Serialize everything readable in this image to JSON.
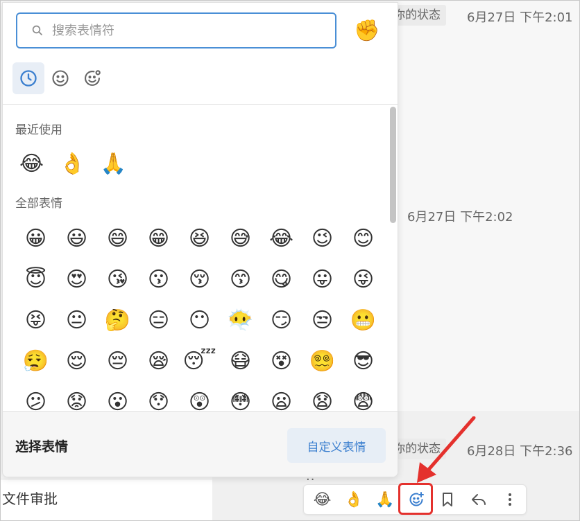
{
  "chat": {
    "status_label": "你的状态",
    "time_1": "6月27日 下午2:01",
    "time_2": "6月27日 下午2:02",
    "status_label_2": "你的状态",
    "time_3": "6月28日 下午2:36",
    "msg_fragment": "..",
    "sidebar_item": "文件审批"
  },
  "picker": {
    "search_placeholder": "搜索表情符",
    "skin_tone_emoji": "✊",
    "tabs": [
      {
        "name": "recent",
        "icon": "clock-icon",
        "active": true
      },
      {
        "name": "smileys",
        "icon": "smiley-icon",
        "active": false
      },
      {
        "name": "custom",
        "icon": "smiley-gear-icon",
        "active": false
      }
    ],
    "recent_title": "最近使用",
    "recent": [
      "😂",
      "👌",
      "🙏"
    ],
    "all_title": "全部表情",
    "all_rows": [
      [
        "😀",
        "😃",
        "😄",
        "😁",
        "😆",
        "😅",
        "😂",
        "😉",
        "😊"
      ],
      [
        "😇",
        "😍",
        "😘",
        "😗",
        "😚",
        "😙",
        "😋",
        "😛",
        "😜"
      ],
      [
        "😝",
        "😐",
        "🤔",
        "😑",
        "😶",
        "😶‍🌫️",
        "😏",
        "😒",
        "😬"
      ],
      [
        "😮‍💨",
        "😌",
        "😔",
        "😪",
        "😴",
        "😷",
        "😵",
        "😵‍💫",
        "😎"
      ],
      [
        "😕",
        "😟",
        "😮",
        "😯",
        "😲",
        "😳",
        "😦",
        "😧",
        "😨"
      ]
    ],
    "footer_title": "选择表情",
    "custom_button": "自定义表情"
  },
  "toolbar": {
    "quick_reactions": [
      "😂",
      "👌",
      "🙏"
    ],
    "add_reaction_icon": "add-reaction-icon",
    "bookmark_icon": "bookmark-icon",
    "reply_icon": "reply-icon",
    "more_icon": "more-vertical-icon"
  },
  "colors": {
    "accent": "#4a8fd6",
    "highlight": "#e4312d"
  }
}
